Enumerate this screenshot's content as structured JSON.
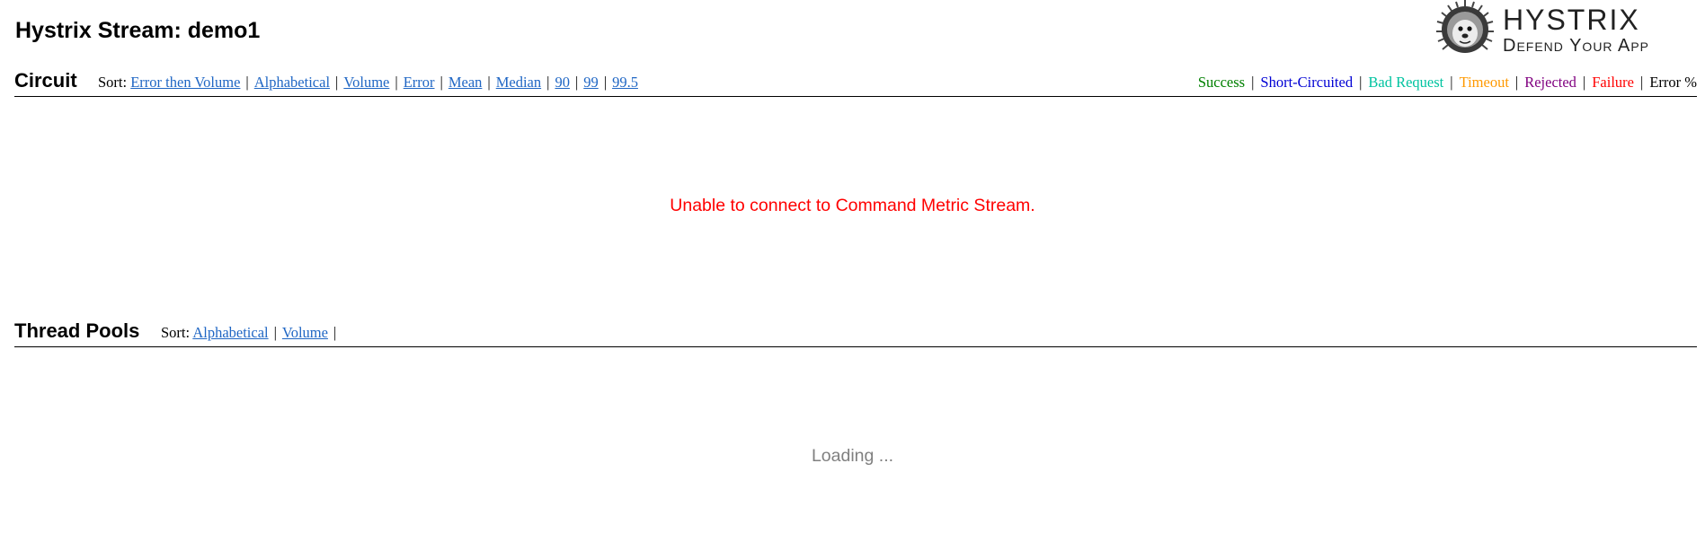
{
  "page": {
    "title": "Hystrix Stream: demo1"
  },
  "logo": {
    "name": "Hystrix",
    "tagline": "Defend Your App"
  },
  "circuit": {
    "title": "Circuit",
    "sort_label": "Sort:",
    "sort_links": [
      "Error then Volume",
      "Alphabetical",
      "Volume",
      "Error",
      "Mean",
      "Median",
      "90",
      "99",
      "99.5"
    ],
    "legend": [
      {
        "label": "Success",
        "color": "#008000"
      },
      {
        "label": "Short-Circuited",
        "color": "#0000d4"
      },
      {
        "label": "Bad Request",
        "color": "#00c3a0"
      },
      {
        "label": "Timeout",
        "color": "#ff9900"
      },
      {
        "label": "Rejected",
        "color": "#800080"
      },
      {
        "label": "Failure",
        "color": "#ff0000"
      },
      {
        "label": "Error %",
        "color": "#000000"
      }
    ],
    "message": "Unable to connect to Command Metric Stream.",
    "message_color": "#ff0000"
  },
  "thread_pools": {
    "title": "Thread Pools",
    "sort_label": "Sort:",
    "sort_links": [
      "Alphabetical",
      "Volume"
    ],
    "message": "Loading ...",
    "message_color": "#808080"
  }
}
